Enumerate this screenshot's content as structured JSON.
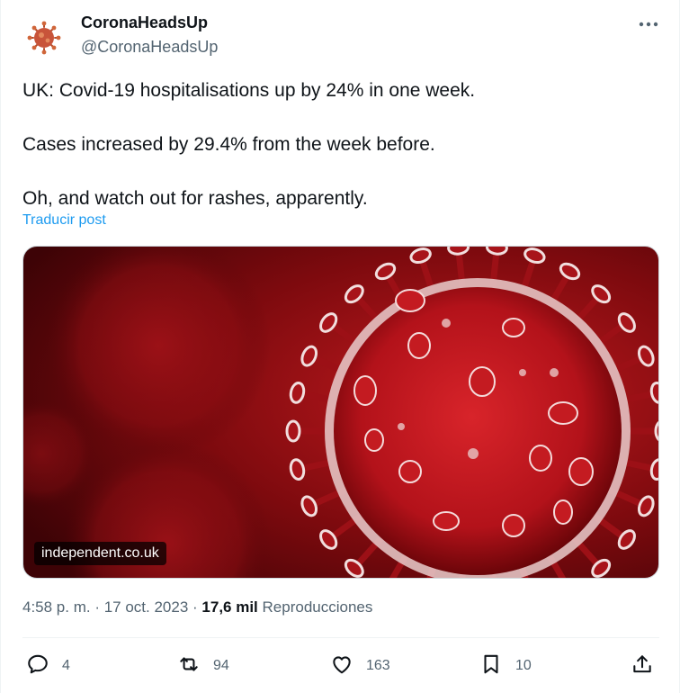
{
  "author": {
    "display_name": "CoronaHeadsUp",
    "handle": "@CoronaHeadsUp",
    "avatar_icon": "coronavirus-avatar-icon"
  },
  "post": {
    "paragraphs": [
      "UK: Covid-19 hospitalisations up by 24% in one week.",
      "Cases increased by 29.4% from the week before.",
      "Oh, and watch out for rashes, apparently."
    ],
    "translate_link": "Traducir post"
  },
  "media": {
    "domain": "independent.co.uk",
    "image_icon": "virus-image"
  },
  "meta": {
    "time": "4:58 p. m.",
    "separator": " · ",
    "date": "17 oct. 2023",
    "views_count": "17,6 mil",
    "views_label": "Reproducciones"
  },
  "actions": {
    "replies": "4",
    "reposts": "94",
    "likes": "163",
    "bookmarks": "10"
  },
  "colors": {
    "text": "#0f1419",
    "secondary": "#536471",
    "link": "#1d9bf0",
    "virus_red": "#b3121a"
  }
}
